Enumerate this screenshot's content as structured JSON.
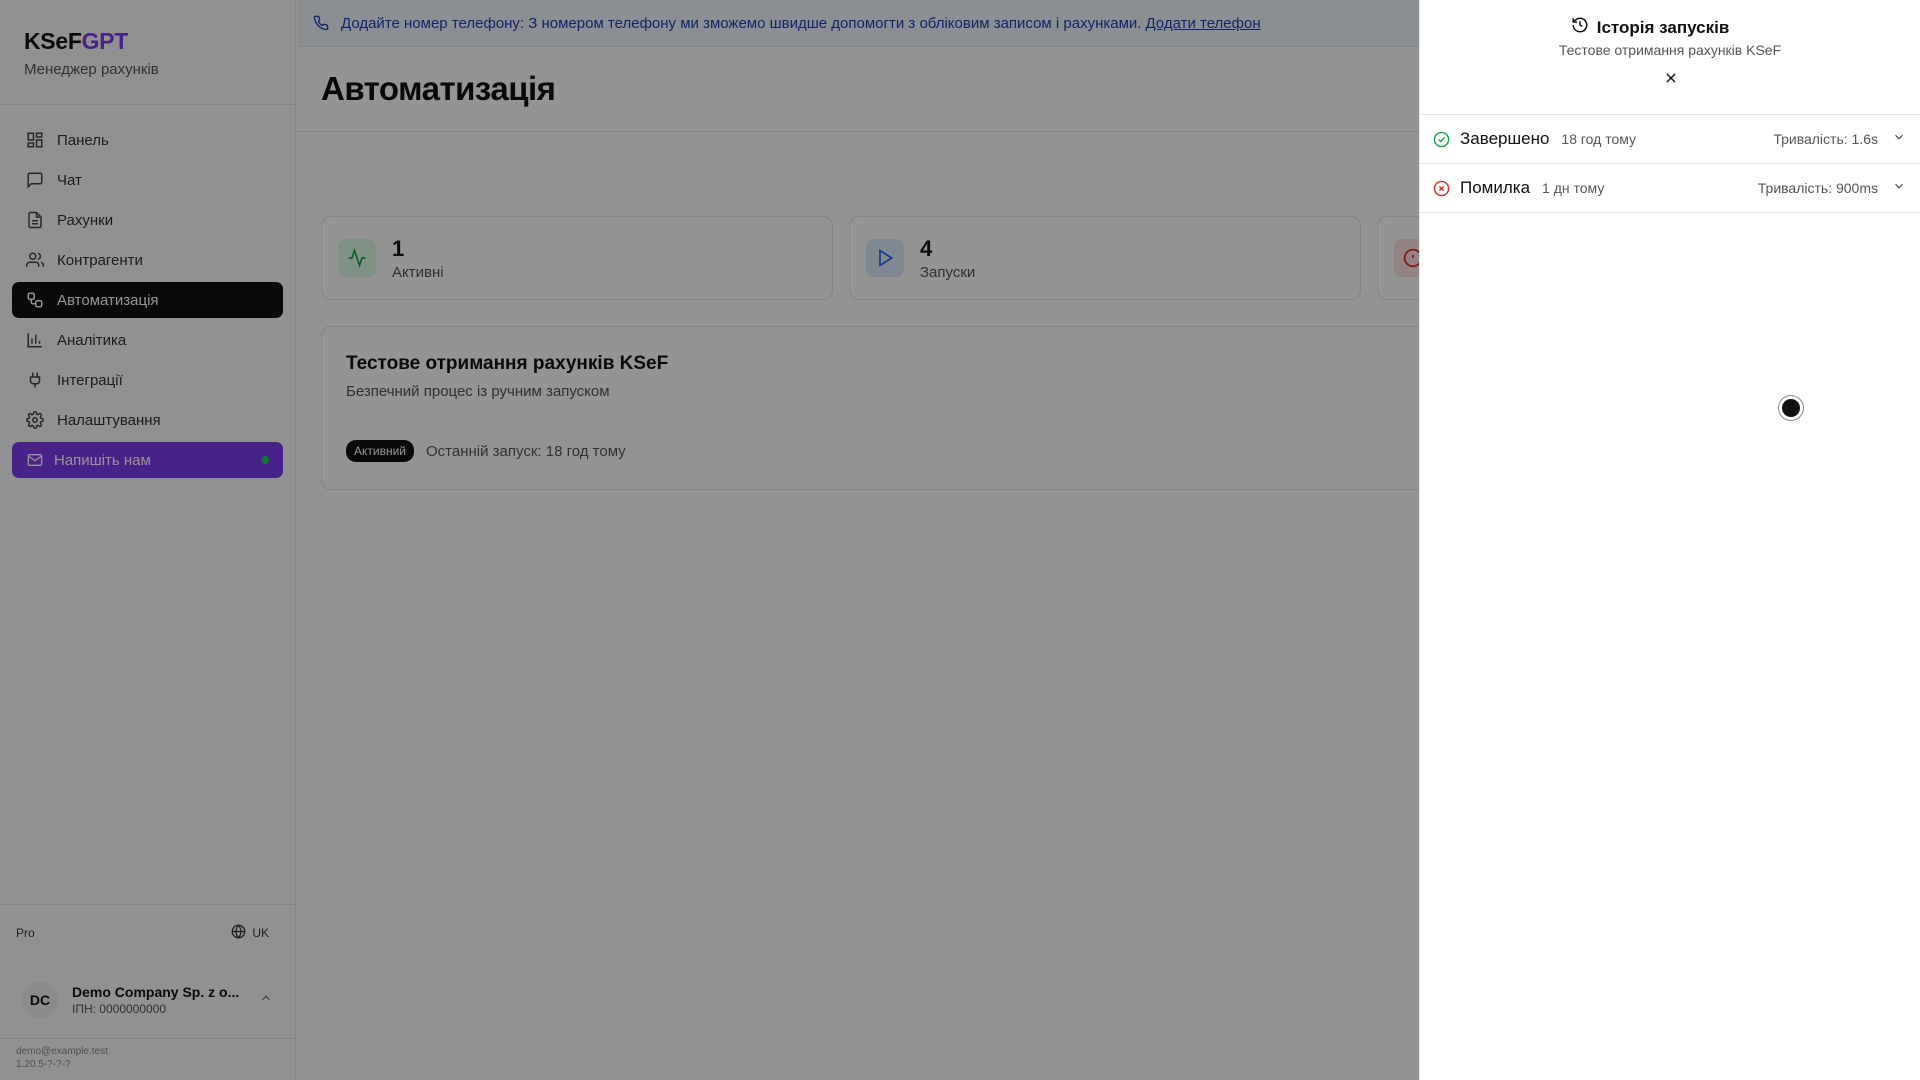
{
  "brand": {
    "title_main": "KSeF",
    "title_accent": "GPT",
    "subtitle": "Менеджер рахунків",
    "accent_color": "#7c3aed"
  },
  "sidebar": {
    "items": [
      {
        "label": "Панель",
        "icon": "dashboard-icon"
      },
      {
        "label": "Чат",
        "icon": "chat-icon"
      },
      {
        "label": "Рахунки",
        "icon": "document-icon"
      },
      {
        "label": "Контрагенти",
        "icon": "users-icon"
      },
      {
        "label": "Автоматизація",
        "icon": "workflow-icon",
        "active": true
      },
      {
        "label": "Аналітика",
        "icon": "bar-chart-icon"
      },
      {
        "label": "Інтеграції",
        "icon": "plug-icon"
      },
      {
        "label": "Налаштування",
        "icon": "gear-icon"
      }
    ],
    "contact_label": "Напишіть нам",
    "plan": "Pro",
    "language": "UK",
    "company": {
      "initials": "DC",
      "name": "Demo Company Sp. z o...",
      "tax_id": "ІПН: 0000000000"
    },
    "footer_email": "demo@example.test",
    "footer_version": "1.20.5-?-?-?"
  },
  "banner": {
    "text": "Додайте номер телефону: З номером телефону ми зможемо швидше допомогти з обліковим записом і рахунками.",
    "link": "Додати телефон"
  },
  "main": {
    "title": "Автоматизація",
    "stats": [
      {
        "value": "1",
        "label": "Активні",
        "icon": "activity-icon",
        "color": "#16a34a",
        "bg": "#dcfce7"
      },
      {
        "value": "4",
        "label": "Запуски",
        "icon": "play-icon",
        "color": "#2563eb",
        "bg": "#dbeafe"
      },
      {
        "value": "",
        "label": "",
        "icon": "alert-icon",
        "color": "#dc2626",
        "bg": "#fee2e2"
      }
    ],
    "automation": {
      "title": "Тестове отримання рахунків KSeF",
      "description": "Безпечний процес із ручним запуском",
      "badge": "Активний",
      "last_run": "Останній запуск: 18 год тому"
    }
  },
  "drawer": {
    "title": "Історія запусків",
    "subtitle": "Тестове отримання рахунків KSeF",
    "runs": [
      {
        "status": "Завершено",
        "ago": "18 год тому",
        "duration": "Тривалість: 1.6s",
        "state": "success",
        "color": "#16a34a"
      },
      {
        "status": "Помилка",
        "ago": "1 дн тому",
        "duration": "Тривалість: 900ms",
        "state": "error",
        "color": "#dc2626"
      }
    ]
  }
}
